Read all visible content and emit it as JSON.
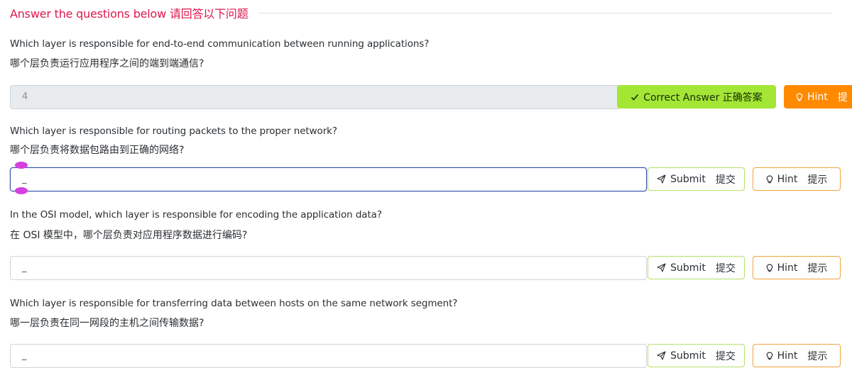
{
  "header": {
    "title": "Answer the questions below   请回答以下问题"
  },
  "labels": {
    "correct_answer": "Correct Answer  正确答案",
    "submit": "Submit",
    "submit_zh": "提交",
    "hint": "Hint",
    "hint_zh": "提示",
    "hint_zh_partial": "提"
  },
  "questions": [
    {
      "text_en": "Which layer is responsible for end-to-end communication between running applications?",
      "text_zh": "哪个层负责运行应用程序之间的端到端通信?",
      "answer_value": "4",
      "state": "correct"
    },
    {
      "text_en": "Which layer is responsible for routing packets to the proper network?",
      "text_zh": "哪个层负责将数据包路由到正确的网络?",
      "answer_value": "_",
      "state": "focused"
    },
    {
      "text_en": "In the OSI model, which layer is responsible for encoding the application data?",
      "text_zh": "在 OSI 模型中，哪个层负责对应用程序数据进行编码?",
      "answer_value": "_",
      "state": "empty"
    },
    {
      "text_en": "Which layer is responsible for transferring data between hosts on the same network segment?",
      "text_zh": "哪一层负责在同一网段的主机之间传输数据?",
      "answer_value": "_",
      "state": "empty"
    }
  ],
  "colors": {
    "accent_title": "#e0174c",
    "correct_button": "#a3e635",
    "hint_button": "#ff8a00",
    "focus_border": "#2f4fa8",
    "caret_handle": "#d63fe0"
  },
  "icons": {
    "correct": "check-icon",
    "submit": "paper-plane-icon",
    "hint": "lightbulb-icon"
  }
}
